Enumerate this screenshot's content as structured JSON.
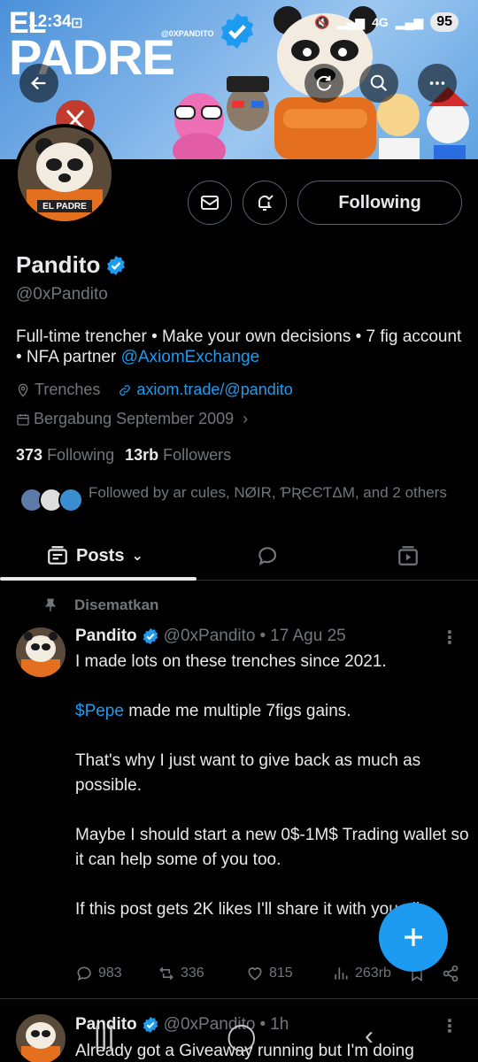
{
  "status_bar": {
    "time": "12:34",
    "network": "4G",
    "battery": "95"
  },
  "banner": {
    "brand_line1": "EL",
    "brand_line2": "PADRE",
    "handle_tag": "@0XPANDITO"
  },
  "header": {
    "back": "back-arrow-icon",
    "refresh": "refresh-icon",
    "search": "search-icon",
    "more": "more-icon"
  },
  "profile": {
    "avatar_label": "EL PADRE",
    "follow_button": "Following",
    "name": "Pandito",
    "username": "@0xPandito",
    "bio_text": "Full-time trencher • Make your own decisions • 7 fig account • NFA partner ",
    "bio_link": "@AxiomExchange",
    "location": "Trenches",
    "website": "axiom.trade/@pandito",
    "joined": "Bergabung September 2009",
    "following_count": "373",
    "following_label": "Following",
    "followers_count": "13rb",
    "followers_label": "Followers",
    "followed_by": "Followed by ar cules, NØIR, ƤƦЄЄƬΔM, and 2 others"
  },
  "tabs": [
    {
      "label": "Posts",
      "icon": "posts-icon"
    },
    {
      "label": "",
      "icon": "reply-icon"
    },
    {
      "label": "",
      "icon": "media-icon"
    }
  ],
  "pinned_label": "Disematkan",
  "posts": [
    {
      "name": "Pandito",
      "handle": "@0xPandito",
      "time": "17 Agu 25",
      "text_before": "I made lots on these trenches since 2021.\n\n",
      "cashtag": "$Pepe",
      "text_after": " made me multiple 7figs gains.\n\nThat's why I just want to give back as much as possible.\n\nMaybe I should start a new 0$-1M$ Trading wallet so it can help some of you too.\n\nIf this post gets 2K likes I'll share it with you all.",
      "replies": "983",
      "reposts": "336",
      "likes": "815",
      "views": "263rb"
    },
    {
      "name": "Pandito",
      "handle": "@0xPandito",
      "time": "1h",
      "text": "Already got a Giveaway running but I'm doing"
    }
  ],
  "colors": {
    "accent": "#1d9bf0",
    "background": "#000000",
    "muted": "#71767b",
    "text": "#e7e9ea"
  }
}
